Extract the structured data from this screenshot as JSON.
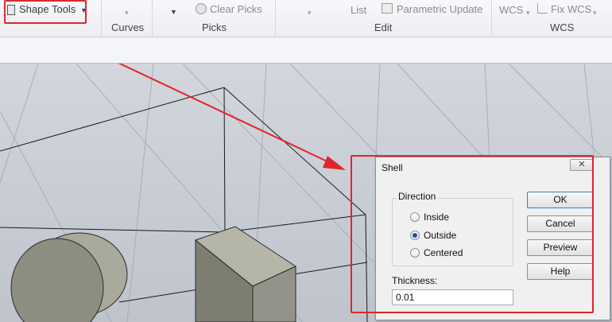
{
  "ribbon": {
    "shape_tools_label": "Shape Tools",
    "clear_picks_label": "Clear Picks",
    "list_label": "List",
    "parametric_update_label": "Parametric Update",
    "wcs_label": "WCS",
    "fix_wcs_label": "Fix WCS",
    "groups": {
      "curves": "Curves",
      "picks": "Picks",
      "edit": "Edit",
      "wcs": "WCS"
    }
  },
  "dialog": {
    "title": "Shell",
    "close_glyph": "✕",
    "direction_label": "Direction",
    "options": [
      "Inside",
      "Outside",
      "Centered"
    ],
    "selected": "Outside",
    "thickness_label": "Thickness:",
    "thickness_value": "0.01",
    "buttons": {
      "ok": "OK",
      "cancel": "Cancel",
      "preview": "Preview",
      "help": "Help"
    }
  },
  "colors": {
    "annotation": "#e0262c",
    "viewport_bg": "#c8ccd4",
    "shape_fill": "#8b8b80",
    "radio_dot": "#1f4fa5"
  }
}
